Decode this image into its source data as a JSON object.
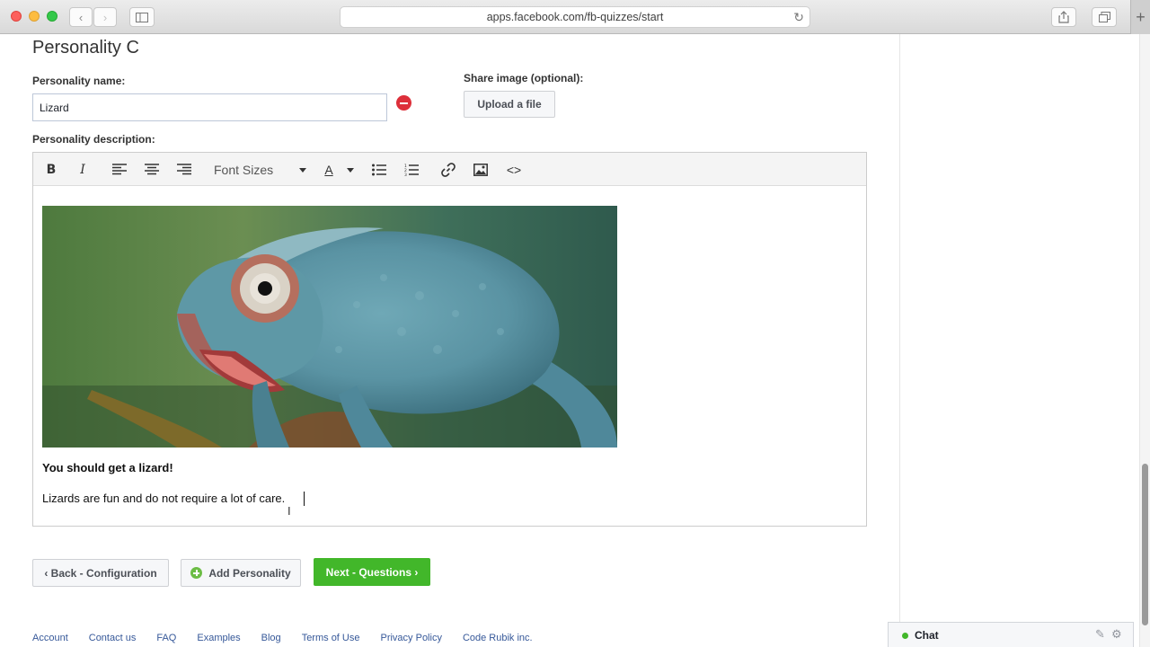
{
  "browser": {
    "url": "apps.facebook.com/fb-quizzes/start"
  },
  "section": {
    "title": "Personality C"
  },
  "form": {
    "name_label": "Personality name:",
    "name_value": "Lizard",
    "share_label": "Share image (optional):",
    "upload_label": "Upload a file",
    "description_label": "Personality description:"
  },
  "editor": {
    "toolbar": {
      "font_sizes": "Font Sizes",
      "bold": "B",
      "italic": "I",
      "text_color": "A",
      "code": "<>"
    },
    "heading": "You should get a lizard!",
    "body": "Lizards are fun and do not require a lot of care."
  },
  "actions": {
    "back": "‹ Back - Configuration",
    "add": "Add Personality",
    "next": "Next - Questions ›"
  },
  "footer": {
    "links": [
      "Account",
      "Contact us",
      "FAQ",
      "Examples",
      "Blog",
      "Terms of Use",
      "Privacy Policy",
      "Code Rubik inc."
    ]
  },
  "chat": {
    "label": "Chat"
  },
  "colors": {
    "accent_green": "#42b72a",
    "link_blue": "#365899",
    "remove_red": "#dd2f3a"
  },
  "icons": [
    "close-icon",
    "minimize-icon",
    "maximize-icon",
    "back-arrow-icon",
    "forward-arrow-icon",
    "sidebar-icon",
    "reload-icon",
    "share-icon",
    "tabs-icon",
    "remove-icon",
    "bold-icon",
    "italic-icon",
    "align-left-icon",
    "align-center-icon",
    "align-right-icon",
    "text-color-icon",
    "bullet-list-icon",
    "numbered-list-icon",
    "link-icon",
    "image-icon",
    "code-icon",
    "plus-circle-icon",
    "compose-icon",
    "gear-icon"
  ]
}
